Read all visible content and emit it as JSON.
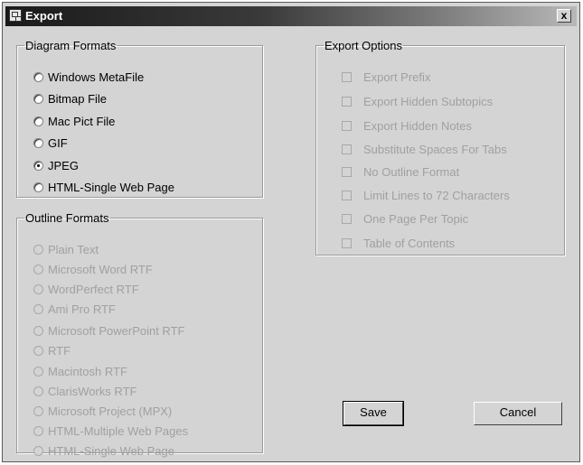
{
  "window": {
    "title": "Export",
    "close_label": "x"
  },
  "diagram_formats": {
    "legend": "Diagram Formats",
    "options": [
      {
        "label": "Windows MetaFile",
        "selected": false
      },
      {
        "label": "Bitmap File",
        "selected": false
      },
      {
        "label": "Mac Pict File",
        "selected": false
      },
      {
        "label": "GIF",
        "selected": false
      },
      {
        "label": "JPEG",
        "selected": true
      },
      {
        "label": "HTML-Single Web Page",
        "selected": false
      }
    ]
  },
  "outline_formats": {
    "legend": "Outline Formats",
    "disabled": true,
    "options": [
      {
        "label": "Plain Text"
      },
      {
        "label": "Microsoft Word RTF"
      },
      {
        "label": "WordPerfect RTF"
      },
      {
        "label": "Ami Pro RTF"
      },
      {
        "label": "Microsoft PowerPoint RTF"
      },
      {
        "label": "RTF"
      },
      {
        "label": "Macintosh RTF"
      },
      {
        "label": "ClarisWorks RTF"
      },
      {
        "label": "Microsoft Project (MPX)"
      },
      {
        "label": "HTML-Multiple Web Pages"
      },
      {
        "label": "HTML-Single Web Page"
      }
    ]
  },
  "export_options": {
    "legend": "Export Options",
    "disabled": true,
    "options": [
      {
        "label": "Export Prefix",
        "checked": false
      },
      {
        "label": "Export Hidden Subtopics",
        "checked": false
      },
      {
        "label": "Export Hidden Notes",
        "checked": false
      },
      {
        "label": "Substitute Spaces For Tabs",
        "checked": false
      },
      {
        "label": "No Outline Format",
        "checked": false
      },
      {
        "label": "Limit Lines to 72 Characters",
        "checked": false
      },
      {
        "label": "One Page Per Topic",
        "checked": false
      },
      {
        "label": "Table of Contents",
        "checked": false
      }
    ]
  },
  "buttons": {
    "save": "Save",
    "cancel": "Cancel"
  }
}
